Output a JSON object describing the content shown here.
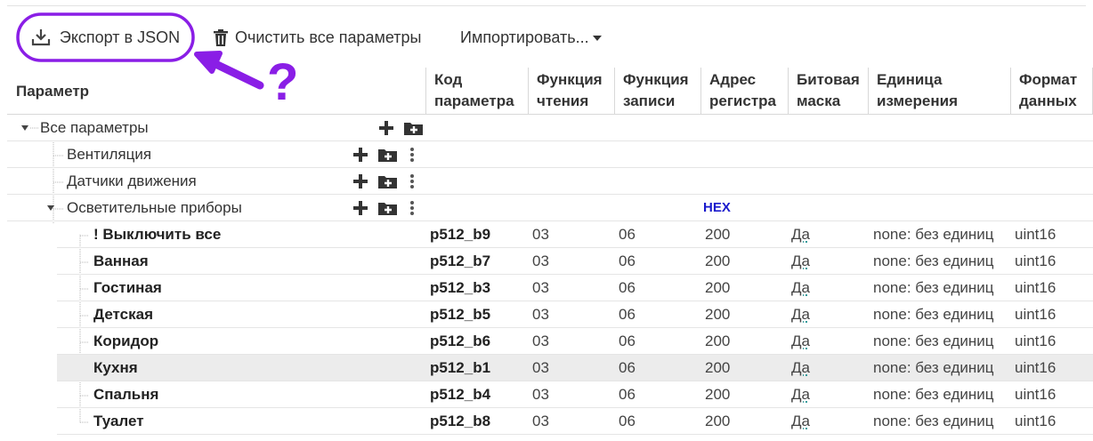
{
  "toolbar": {
    "export_label": "Экспорт в JSON",
    "clear_label": "Очистить все параметры",
    "import_label": "Импортировать..."
  },
  "annotation": {
    "question": "?",
    "color": "#8a1ee6"
  },
  "columns": {
    "param": "Параметр",
    "code": [
      "Код",
      "параметра"
    ],
    "read": [
      "Функция",
      "чтения"
    ],
    "write": [
      "Функция",
      "записи"
    ],
    "addr": [
      "Адрес",
      "регистра"
    ],
    "mask": [
      "Битовая",
      "маска"
    ],
    "unit": [
      "Единица",
      "измерения"
    ],
    "format": [
      "Формат",
      "данных"
    ]
  },
  "tree": {
    "root": "Все параметры",
    "groups": [
      "Вентиляция",
      "Датчики движения",
      "Осветительные приборы"
    ],
    "hex_label": "HEX"
  },
  "rows": [
    {
      "name": "! Выключить все",
      "code": "p512_b9",
      "read": "03",
      "write": "06",
      "addr": "200",
      "mask": "Да",
      "unit": "none: без единиц",
      "format": "uint16"
    },
    {
      "name": "Ванная",
      "code": "p512_b7",
      "read": "03",
      "write": "06",
      "addr": "200",
      "mask": "Да",
      "unit": "none: без единиц",
      "format": "uint16"
    },
    {
      "name": "Гостиная",
      "code": "p512_b3",
      "read": "03",
      "write": "06",
      "addr": "200",
      "mask": "Да",
      "unit": "none: без единиц",
      "format": "uint16"
    },
    {
      "name": "Детская",
      "code": "p512_b5",
      "read": "03",
      "write": "06",
      "addr": "200",
      "mask": "Да",
      "unit": "none: без единиц",
      "format": "uint16"
    },
    {
      "name": "Коридор",
      "code": "p512_b6",
      "read": "03",
      "write": "06",
      "addr": "200",
      "mask": "Да",
      "unit": "none: без единиц",
      "format": "uint16"
    },
    {
      "name": "Кухня",
      "code": "p512_b1",
      "read": "03",
      "write": "06",
      "addr": "200",
      "mask": "Да",
      "unit": "none: без единиц",
      "format": "uint16"
    },
    {
      "name": "Спальня",
      "code": "p512_b4",
      "read": "03",
      "write": "06",
      "addr": "200",
      "mask": "Да",
      "unit": "none: без единиц",
      "format": "uint16"
    },
    {
      "name": "Туалет",
      "code": "p512_b8",
      "read": "03",
      "write": "06",
      "addr": "200",
      "mask": "Да",
      "unit": "none: без единиц",
      "format": "uint16"
    }
  ]
}
